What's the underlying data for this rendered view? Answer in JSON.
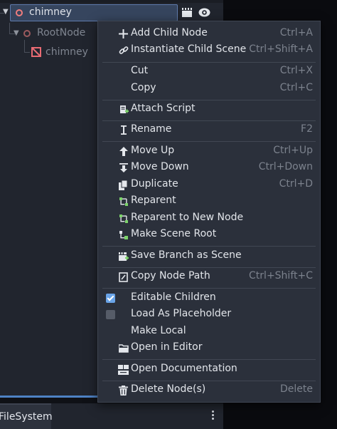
{
  "scene_tree": {
    "selected_node": "chimney",
    "rows": [
      {
        "label": "RootNode"
      },
      {
        "label": "chimney"
      }
    ]
  },
  "bottom": {
    "tab_label": "FileSystem"
  },
  "context_menu": {
    "items": [
      {
        "label": "Add Child Node",
        "shortcut": "Ctrl+A",
        "icon": "plus-icon"
      },
      {
        "label": "Instantiate Child Scene",
        "shortcut": "Ctrl+Shift+A",
        "icon": "link-icon"
      },
      {
        "label": "Cut",
        "shortcut": "Ctrl+X",
        "icon": ""
      },
      {
        "label": "Copy",
        "shortcut": "Ctrl+C",
        "icon": ""
      },
      {
        "label": "Attach Script",
        "shortcut": "",
        "icon": "script-add-icon"
      },
      {
        "label": "Rename",
        "shortcut": "F2",
        "icon": "text-cursor-icon"
      },
      {
        "label": "Move Up",
        "shortcut": "Ctrl+Up",
        "icon": "arrow-up-icon"
      },
      {
        "label": "Move Down",
        "shortcut": "Ctrl+Down",
        "icon": "arrow-down-icon"
      },
      {
        "label": "Duplicate",
        "shortcut": "Ctrl+D",
        "icon": "duplicate-icon"
      },
      {
        "label": "Reparent",
        "shortcut": "",
        "icon": "reparent-icon"
      },
      {
        "label": "Reparent to New Node",
        "shortcut": "",
        "icon": "reparent-new-icon"
      },
      {
        "label": "Make Scene Root",
        "shortcut": "",
        "icon": "scene-root-icon"
      },
      {
        "label": "Save Branch as Scene",
        "shortcut": "",
        "icon": "save-branch-icon"
      },
      {
        "label": "Copy Node Path",
        "shortcut": "Ctrl+Shift+C",
        "icon": "copy-path-icon"
      },
      {
        "label": "Editable Children",
        "shortcut": "",
        "icon": "checkbox-checked",
        "checked": true
      },
      {
        "label": "Load As Placeholder",
        "shortcut": "",
        "icon": "checkbox-unchecked",
        "checked": false
      },
      {
        "label": "Make Local",
        "shortcut": "",
        "icon": ""
      },
      {
        "label": "Open in Editor",
        "shortcut": "",
        "icon": "folder-icon"
      },
      {
        "label": "Open Documentation",
        "shortcut": "",
        "icon": "doc-icon"
      },
      {
        "label": "Delete Node(s)",
        "shortcut": "Delete",
        "icon": "trash-icon"
      }
    ]
  },
  "colors": {
    "accent": "#6aa4e8",
    "node_icon": "#f07d7d",
    "mesh_icon": "#e86b73",
    "selection": "#36455e"
  }
}
